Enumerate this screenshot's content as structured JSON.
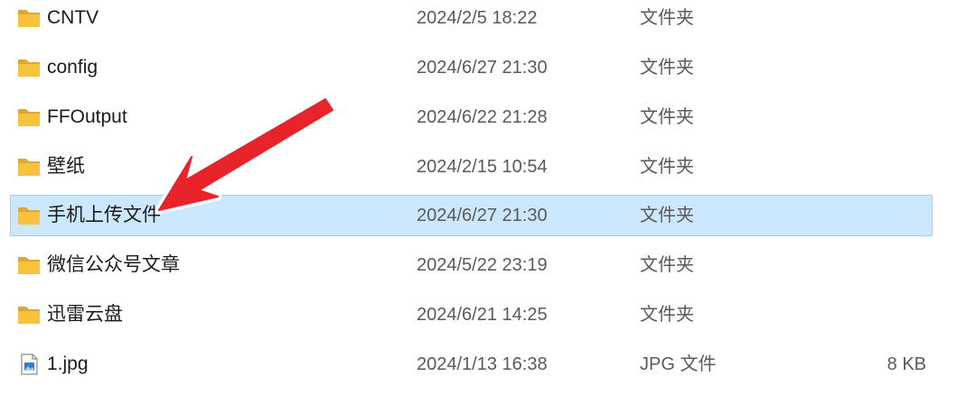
{
  "files": [
    {
      "name": "CNTV",
      "date": "2024/2/5 18:22",
      "type": "文件夹",
      "size": "",
      "icon": "folder-icon",
      "selected": false
    },
    {
      "name": "config",
      "date": "2024/6/27 21:30",
      "type": "文件夹",
      "size": "",
      "icon": "folder-icon",
      "selected": false
    },
    {
      "name": "FFOutput",
      "date": "2024/6/22 21:28",
      "type": "文件夹",
      "size": "",
      "icon": "folder-icon",
      "selected": false
    },
    {
      "name": "壁纸",
      "date": "2024/2/15 10:54",
      "type": "文件夹",
      "size": "",
      "icon": "folder-icon",
      "selected": false
    },
    {
      "name": "手机上传文件",
      "date": "2024/6/27 21:30",
      "type": "文件夹",
      "size": "",
      "icon": "folder-icon",
      "selected": true
    },
    {
      "name": "微信公众号文章",
      "date": "2024/5/22 23:19",
      "type": "文件夹",
      "size": "",
      "icon": "folder-icon",
      "selected": false
    },
    {
      "name": "迅雷云盘",
      "date": "2024/6/21 14:25",
      "type": "文件夹",
      "size": "",
      "icon": "folder-icon",
      "selected": false
    },
    {
      "name": "1.jpg",
      "date": "2024/1/13 16:38",
      "type": "JPG 文件",
      "size": "8 KB",
      "icon": "image-file-icon",
      "selected": false
    }
  ],
  "annotation": {
    "type": "arrow-annotation",
    "color": "#e8232a",
    "target_row": "手机上传文件"
  },
  "colors": {
    "selection_bg": "#cce8ff",
    "selection_border": "#99d1ff",
    "folder": "#f8c33c"
  }
}
